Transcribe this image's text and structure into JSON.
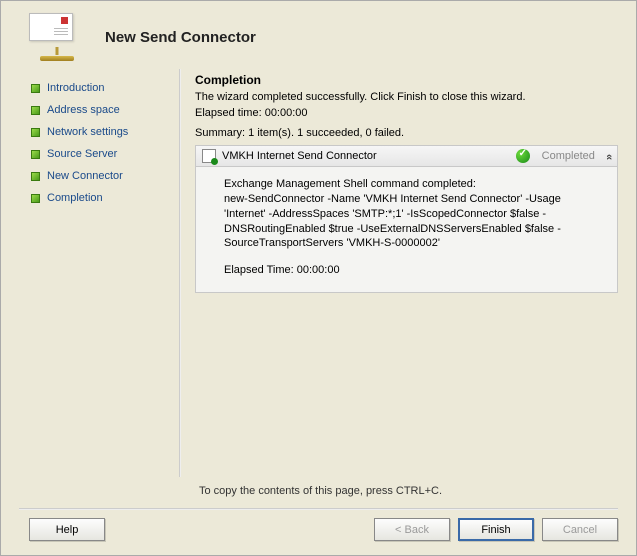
{
  "header": {
    "title": "New Send Connector"
  },
  "sidebar": {
    "items": [
      {
        "label": "Introduction"
      },
      {
        "label": "Address space"
      },
      {
        "label": "Network settings"
      },
      {
        "label": "Source Server"
      },
      {
        "label": "New Connector"
      },
      {
        "label": "Completion"
      }
    ]
  },
  "content": {
    "heading": "Completion",
    "subheading": "The wizard completed successfully. Click Finish to close this wizard.",
    "elapsed_line": "Elapsed time: 00:00:00",
    "summary": "Summary: 1 item(s). 1 succeeded, 0 failed.",
    "item": {
      "name": "VMKH Internet Send Connector",
      "status": "Completed",
      "body_intro": "Exchange Management Shell command completed:",
      "body_cmd": "new-SendConnector -Name 'VMKH Internet Send Connector' -Usage 'Internet' -AddressSpaces 'SMTP:*;1' -IsScopedConnector $false -DNSRoutingEnabled $true -UseExternalDNSServersEnabled $false -SourceTransportServers 'VMKH-S-0000002'",
      "body_elapsed": "Elapsed Time: 00:00:00"
    }
  },
  "footer": {
    "hint": "To copy the contents of this page, press CTRL+C.",
    "buttons": {
      "help": "Help",
      "back": "< Back",
      "finish": "Finish",
      "cancel": "Cancel"
    }
  }
}
